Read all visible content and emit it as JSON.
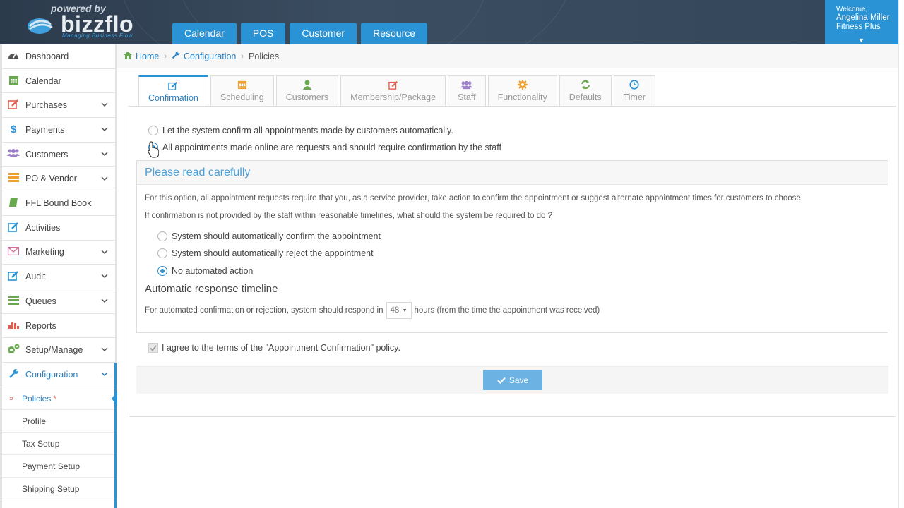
{
  "brand": {
    "powered": "powered by",
    "name": "bizzflo",
    "tagline": "Managing Business Flow"
  },
  "topnav": [
    "Calendar",
    "POS",
    "Customer",
    "Resource"
  ],
  "user": {
    "welcome": "Welcome,",
    "name": "Angelina Miller",
    "org": "Fitness Plus"
  },
  "sidebar": {
    "items": [
      {
        "label": "Dashboard",
        "icon": "tachometer-icon",
        "color": "#555"
      },
      {
        "label": "Calendar",
        "icon": "calendar-icon",
        "color": "#6aa84f"
      },
      {
        "label": "Purchases",
        "icon": "edit-icon",
        "color": "#e06050"
      },
      {
        "label": "Payments",
        "icon": "dollar-icon",
        "color": "#2a93d5"
      },
      {
        "label": "Customers",
        "icon": "users-icon",
        "color": "#9b7fc9"
      },
      {
        "label": "PO & Vendor",
        "icon": "list-icon",
        "color": "#f0a030"
      },
      {
        "label": "FFL Bound Book",
        "icon": "book-icon",
        "color": "#6aa84f"
      },
      {
        "label": "Activities",
        "icon": "edit-icon",
        "color": "#2a93d5"
      },
      {
        "label": "Marketing",
        "icon": "envelope-icon",
        "color": "#d36a9b"
      },
      {
        "label": "Audit",
        "icon": "edit-icon",
        "color": "#2a93d5"
      },
      {
        "label": "Queues",
        "icon": "list-icon",
        "color": "#6aa84f"
      },
      {
        "label": "Reports",
        "icon": "bar-chart-icon",
        "color": "#e06050"
      },
      {
        "label": "Setup/Manage",
        "icon": "gears-icon",
        "color": "#6aa84f"
      },
      {
        "label": "Configuration",
        "icon": "wrench-icon",
        "color": "#2a93d5"
      }
    ],
    "sub_items": [
      "Policies",
      "Profile",
      "Tax Setup",
      "Payment Setup",
      "Shipping Setup"
    ],
    "sub_star": "*"
  },
  "breadcrumb": {
    "home": "Home",
    "config": "Configuration",
    "current": "Policies"
  },
  "tabs": [
    {
      "label": "Confirmation",
      "icon": "edit-icon",
      "color": "#2a93d5"
    },
    {
      "label": "Scheduling",
      "icon": "calendar-icon",
      "color": "#f0a030"
    },
    {
      "label": "Customers",
      "icon": "user-icon",
      "color": "#6aa84f"
    },
    {
      "label": "Membership/Package",
      "icon": "edit-icon",
      "color": "#e06050"
    },
    {
      "label": "Staff",
      "icon": "users-icon",
      "color": "#9b7fc9"
    },
    {
      "label": "Functionality",
      "icon": "gear-icon",
      "color": "#f0a030"
    },
    {
      "label": "Defaults",
      "icon": "refresh-icon",
      "color": "#6aa84f"
    },
    {
      "label": "Timer",
      "icon": "clock-icon",
      "color": "#2a93d5"
    }
  ],
  "confirmation": {
    "option_auto": "Let the system confirm all appointments made by customers automatically.",
    "option_requests": "All appointments made online are requests and should require confirmation by the staff",
    "notice_title": "Please read carefully",
    "notice_text": "For this option, all appointment requests require that you, as a service provider, take action to confirm the appointment or suggest alternate appointment times for customers to choose.",
    "question": "If confirmation is not provided by the staff within reasonable timelines, what should the system be required to do ?",
    "fallback_options": [
      "System should automatically confirm the appointment",
      "System should automatically reject the appointment",
      "No automated action"
    ],
    "selected_fallback": "No automated action",
    "timeline_title": "Automatic response timeline",
    "respond_prefix": "For automated confirmation or rejection, system should respond in",
    "hours_value": "48",
    "respond_suffix": "hours (from the time the appointment was received)",
    "agree_text": "I agree to the terms of the \"Appointment Confirmation\" policy.",
    "save_label": "Save"
  },
  "colors": {
    "accent": "#2a93d5",
    "header": "#34475a",
    "save": "#6cb3e4"
  }
}
